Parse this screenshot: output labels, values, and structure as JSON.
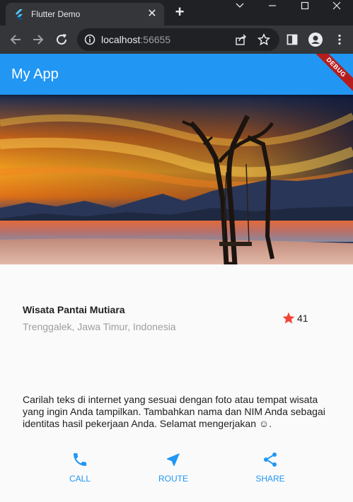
{
  "browser": {
    "tab_title": "Flutter Demo",
    "url_host": "localhost",
    "url_port": ":56655"
  },
  "app": {
    "title": "My App",
    "debug_label": "DEBUG"
  },
  "place": {
    "name": "Wisata Pantai Mutiara",
    "location": "Trenggalek, Jawa Timur, Indonesia",
    "rating": "41"
  },
  "description": "Carilah teks di internet yang sesuai dengan foto atau tempat wisata yang ingin Anda tampilkan. Tambahkan nama dan NIM Anda sebagai identitas hasil pekerjaan Anda. Selamat mengerjakan ☺︎.",
  "actions": [
    {
      "label": "CALL",
      "icon": "phone-icon"
    },
    {
      "label": "ROUTE",
      "icon": "near-me-icon"
    },
    {
      "label": "SHARE",
      "icon": "share-icon"
    }
  ],
  "colors": {
    "primary": "#2196f3",
    "star": "#f44336",
    "debug_banner": "#b71c1c",
    "chrome_dark": "#202124",
    "chrome_toolbar": "#35363a"
  }
}
